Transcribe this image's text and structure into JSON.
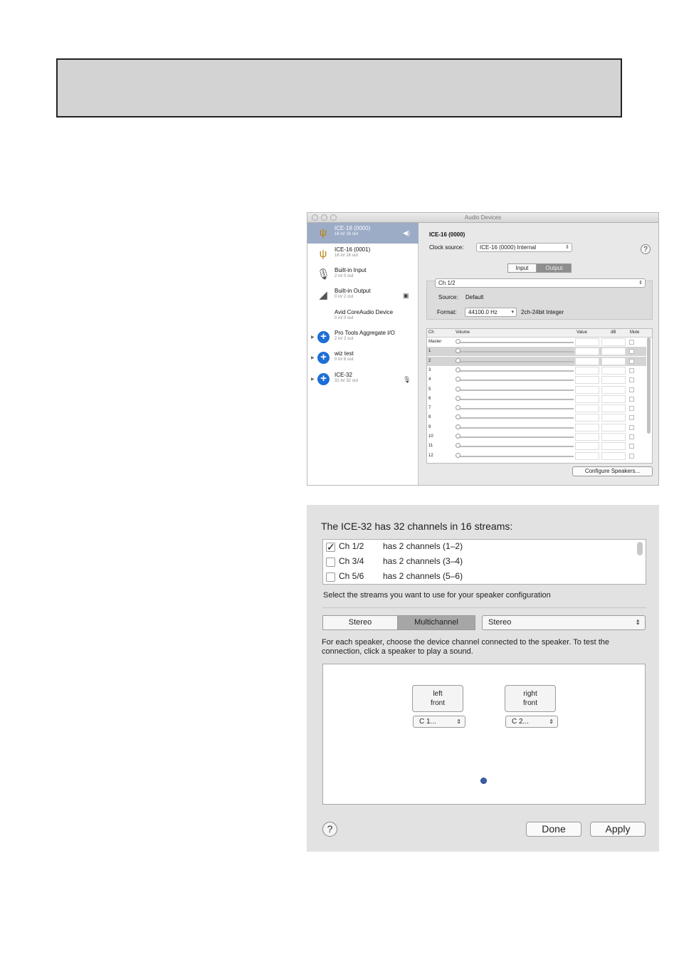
{
  "audio_devices_window": {
    "title": "Audio Devices",
    "devices": [
      {
        "name": "ICE-16 (0000)",
        "io": "16 in/ 16 out",
        "selected": true,
        "icon": "firewire-icon",
        "badge": "speaker-icon"
      },
      {
        "name": "ICE-16 (0001)",
        "io": "16 in/ 16 out",
        "selected": false,
        "icon": "firewire-icon"
      },
      {
        "name": "Built-in Input",
        "io": "2 in/ 0 out",
        "selected": false,
        "icon": "microphone-icon"
      },
      {
        "name": "Built-in Output",
        "io": "0 in/ 2 out",
        "selected": false,
        "icon": "speaker-icon",
        "badge": "system-output-icon"
      },
      {
        "name": "Avid CoreAudio Device",
        "io": "0 in/ 0 out",
        "selected": false
      },
      {
        "name": "Pro Tools Aggregate I/O",
        "io": "2 in/ 2 out",
        "selected": false,
        "icon": "aggregate-plus-icon"
      },
      {
        "name": "wiz test",
        "io": "0 in/ 8 out",
        "selected": false,
        "icon": "aggregate-plus-icon"
      },
      {
        "name": "ICE-32",
        "io": "32 in/ 32 out",
        "selected": false,
        "icon": "aggregate-plus-icon",
        "badge": "microphone-icon"
      }
    ],
    "sidebar_buttons": {
      "add": "+",
      "remove": "–",
      "gear": "⚙▾"
    },
    "detail": {
      "device_title": "ICE-16 (0000)",
      "clock_label": "Clock source:",
      "clock_value": "ICE-16 (0000) Internal",
      "tabs": {
        "input": "Input",
        "output": "Output"
      },
      "active_tab": "output",
      "stream_select": "Ch 1/2",
      "source_label": "Source:",
      "source_value": "Default",
      "format_label": "Format:",
      "format_rate": "44100.0 Hz",
      "format_depth": "2ch-24bit Integer",
      "columns": {
        "ch": "Ch",
        "volume": "Volume",
        "value": "Value",
        "db": "dB",
        "mute": "Mute"
      },
      "channels": [
        {
          "ch": "Master",
          "selected": false
        },
        {
          "ch": "1",
          "selected": true
        },
        {
          "ch": "2",
          "selected": true
        },
        {
          "ch": "3",
          "selected": false
        },
        {
          "ch": "4",
          "selected": false
        },
        {
          "ch": "5",
          "selected": false
        },
        {
          "ch": "6",
          "selected": false
        },
        {
          "ch": "7",
          "selected": false
        },
        {
          "ch": "8",
          "selected": false
        },
        {
          "ch": "9",
          "selected": false
        },
        {
          "ch": "10",
          "selected": false
        },
        {
          "ch": "11",
          "selected": false
        },
        {
          "ch": "12",
          "selected": false
        }
      ],
      "configure_button": "Configure Speakers..."
    }
  },
  "configure_dialog": {
    "heading": "The ICE-32 has 32 channels in 16 streams:",
    "streams": [
      {
        "name": "Ch 1/2",
        "desc": "has 2 channels (1–2)",
        "checked": true
      },
      {
        "name": "Ch 3/4",
        "desc": "has 2 channels (3–4)",
        "checked": false
      },
      {
        "name": "Ch 5/6",
        "desc": "has 2 channels (5–6)",
        "checked": false
      }
    ],
    "stream_hint": "Select the streams you want to use for your speaker configuration",
    "mode_tabs": {
      "stereo": "Stereo",
      "multichannel": "Multichannel"
    },
    "active_mode": "multichannel",
    "config_select": "Stereo",
    "instructions_line1": "For each speaker, choose the device channel connected to the speaker. To test the",
    "instructions_line2": "connection, click a speaker to play a sound.",
    "speakers": [
      {
        "line1": "left",
        "line2": "front",
        "channel": "C   1..."
      },
      {
        "line1": "right",
        "line2": "front",
        "channel": "C   2..."
      }
    ],
    "help": "?",
    "done": "Done",
    "apply": "Apply"
  }
}
